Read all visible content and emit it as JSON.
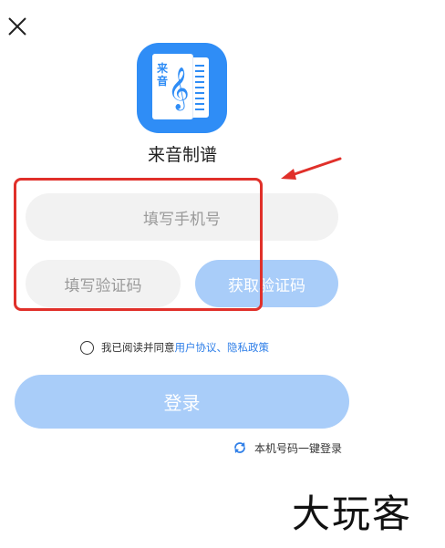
{
  "header": {
    "close_icon": "close-icon"
  },
  "app": {
    "logo_char_top": "来",
    "logo_char_bottom": "音",
    "logo_clef": "𝄞",
    "name": "来音制谱"
  },
  "form": {
    "phone_placeholder": "填写手机号",
    "code_placeholder": "填写验证码",
    "get_code_label": "获取验证码"
  },
  "agreement": {
    "prefix": "我已阅读并同意",
    "user_agreement": "用户协议",
    "separator": "、",
    "privacy_policy": "隐私政策",
    "checked": false
  },
  "login": {
    "label": "登录"
  },
  "one_key_login": {
    "label": "本机号码一键登录",
    "icon": "refresh-icon"
  },
  "annotation": {
    "color": "#e0302a"
  },
  "watermark": {
    "text": "大玩客"
  },
  "colors": {
    "brand": "#2f8df6",
    "button_disabled": "#a9cdf9",
    "link": "#2f7fe8"
  }
}
